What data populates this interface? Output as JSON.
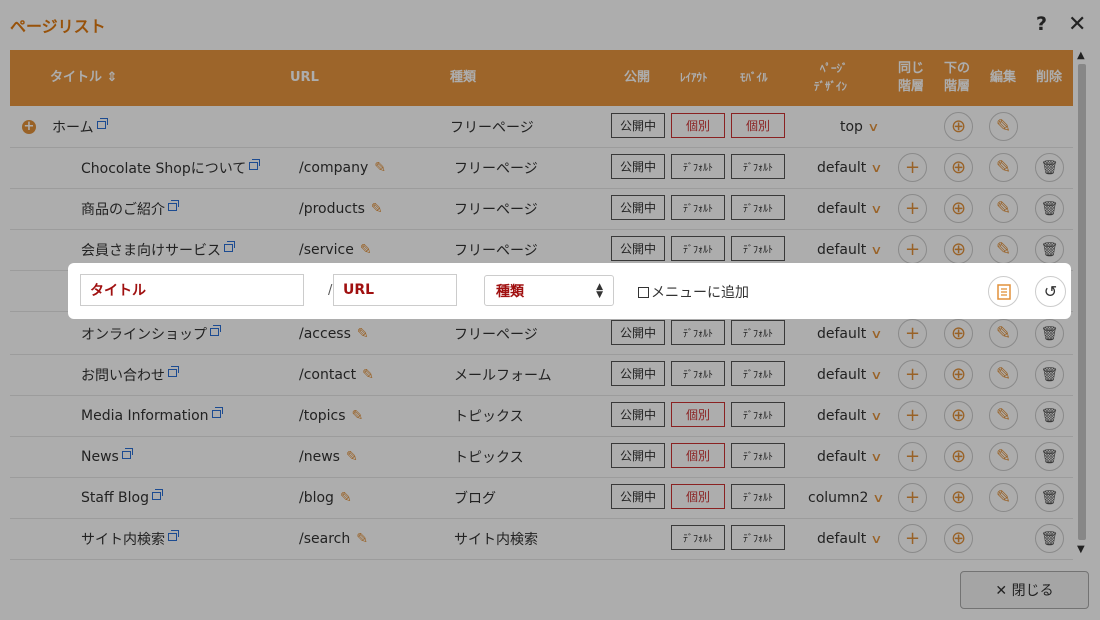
{
  "dialog": {
    "title": "ページリスト",
    "help": "?",
    "close_icon": "✕"
  },
  "header": {
    "title": "タイトル ⇕",
    "url": "URL",
    "type": "種類",
    "public": "公開",
    "layout": "ﾚｲｱｳﾄ",
    "mobile": "ﾓﾊﾞｲﾙ",
    "page_design_1": "ﾍﾟｰｼﾞ",
    "page_design_2": "ﾃﾞｻﾞｲﾝ",
    "same_1": "同じ",
    "same_2": "階層",
    "below_1": "下の",
    "below_2": "階層",
    "edit": "編集",
    "delete": "削除"
  },
  "rows": [
    {
      "title": "ホーム",
      "url": "",
      "type": "フリーページ",
      "public": "公開中",
      "layout": "個別",
      "mobile": "個別",
      "design": "top"
    },
    {
      "title": "Chocolate Shopについて",
      "url": "/company",
      "type": "フリーページ",
      "public": "公開中",
      "layout": "ﾃﾞﾌｫﾙﾄ",
      "mobile": "ﾃﾞﾌｫﾙﾄ",
      "design": "default"
    },
    {
      "title": "商品のご紹介",
      "url": "/products",
      "type": "フリーページ",
      "public": "公開中",
      "layout": "ﾃﾞﾌｫﾙﾄ",
      "mobile": "ﾃﾞﾌｫﾙﾄ",
      "design": "default"
    },
    {
      "title": "会員さま向けサービス",
      "url": "/service",
      "type": "フリーページ",
      "public": "公開中",
      "layout": "ﾃﾞﾌｫﾙﾄ",
      "mobile": "ﾃﾞﾌｫﾙﾄ",
      "design": "default"
    },
    {
      "title": "",
      "url": "",
      "type": "",
      "public": "",
      "layout": "",
      "mobile": "",
      "design": ""
    },
    {
      "title": "オンラインショップ",
      "url": "/access",
      "type": "フリーページ",
      "public": "公開中",
      "layout": "ﾃﾞﾌｫﾙﾄ",
      "mobile": "ﾃﾞﾌｫﾙﾄ",
      "design": "default"
    },
    {
      "title": "お問い合わせ",
      "url": "/contact",
      "type": "メールフォーム",
      "public": "公開中",
      "layout": "ﾃﾞﾌｫﾙﾄ",
      "mobile": "ﾃﾞﾌｫﾙﾄ",
      "design": "default"
    },
    {
      "title": "Media Information",
      "url": "/topics",
      "type": "トピックス",
      "public": "公開中",
      "layout": "個別",
      "mobile": "ﾃﾞﾌｫﾙﾄ",
      "design": "default"
    },
    {
      "title": "News",
      "url": "/news",
      "type": "トピックス",
      "public": "公開中",
      "layout": "個別",
      "mobile": "ﾃﾞﾌｫﾙﾄ",
      "design": "default"
    },
    {
      "title": "Staff Blog",
      "url": "/blog",
      "type": "ブログ",
      "public": "公開中",
      "layout": "個別",
      "mobile": "ﾃﾞﾌｫﾙﾄ",
      "design": "column2"
    },
    {
      "title": "サイト内検索",
      "url": "/search",
      "type": "サイト内検索",
      "public": "",
      "layout": "ﾃﾞﾌｫﾙﾄ",
      "mobile": "ﾃﾞﾌｫﾙﾄ",
      "design": "default"
    }
  ],
  "edit_row": {
    "title_placeholder": "タイトル",
    "slash": "/",
    "url_placeholder": "URL",
    "type_select": "種類",
    "menu_checkbox": "メニューに追加"
  },
  "footer": {
    "close_label": "✕ 閉じる"
  },
  "colors": {
    "accent": "#e7953f",
    "danger": "#cc3333"
  }
}
